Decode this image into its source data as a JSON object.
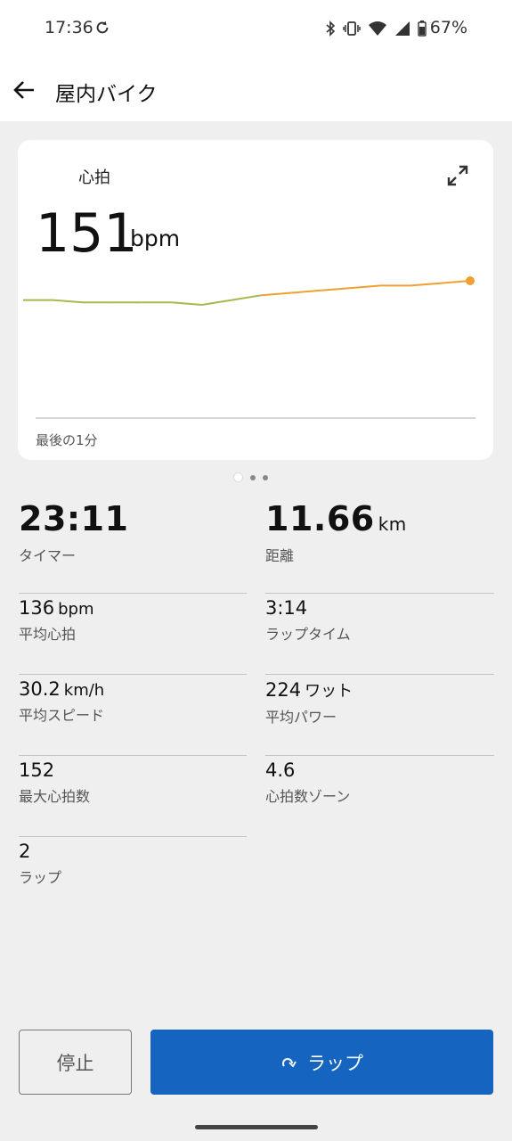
{
  "status_bar": {
    "time": "17:36",
    "battery": "67%"
  },
  "app_bar": {
    "title": "屋内バイク"
  },
  "card": {
    "metric_label": "心拍",
    "value": "151",
    "unit": "bpm",
    "footer": "最後の1分",
    "colors": {
      "low": "#a6b84e",
      "high": "#f0a030"
    }
  },
  "chart_data": {
    "type": "line",
    "x": [
      0,
      4,
      8,
      12,
      16,
      20,
      24,
      28,
      32,
      36,
      40,
      44,
      48,
      52,
      56,
      60
    ],
    "y": [
      138,
      138,
      137,
      137,
      137,
      137,
      136,
      138,
      140,
      141,
      142,
      143,
      144,
      144,
      145,
      146
    ],
    "xlabel": "",
    "ylabel": "",
    "annotations": [
      "最後の1分"
    ],
    "grid": false
  },
  "stats": {
    "timer": {
      "value": "23:11",
      "label": "タイマー"
    },
    "distance": {
      "value": "11.66",
      "unit": "km",
      "label": "距離"
    },
    "avg_hr": {
      "value": "136",
      "unit": "bpm",
      "label": "平均心拍"
    },
    "lap_time": {
      "value": "3:14",
      "label": "ラップタイム"
    },
    "avg_speed": {
      "value": "30.2",
      "unit": "km/h",
      "label": "平均スピード"
    },
    "avg_power": {
      "value": "224",
      "unit": "ワット",
      "label": "平均パワー"
    },
    "max_hr": {
      "value": "152",
      "label": "最大心拍数"
    },
    "hr_zone": {
      "value": "4.6",
      "label": "心拍数ゾーン"
    },
    "laps": {
      "value": "2",
      "label": "ラップ"
    }
  },
  "buttons": {
    "stop": "停止",
    "lap": "ラップ"
  },
  "colors": {
    "primary": "#1565c0"
  }
}
